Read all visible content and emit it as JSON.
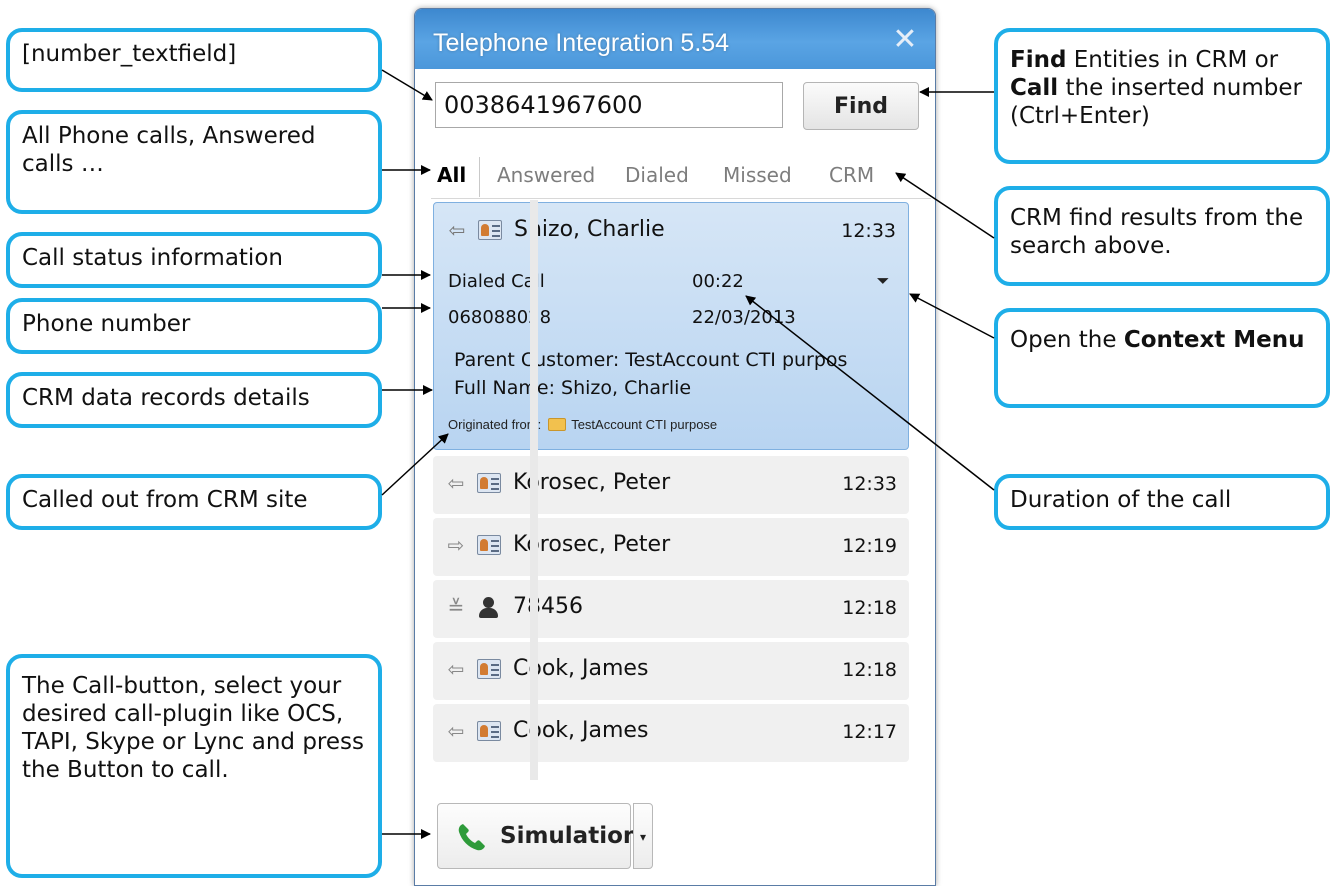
{
  "window": {
    "title": "Telephone Integration 5.54",
    "close_glyph": "✕"
  },
  "search": {
    "number_value": "0038641967600",
    "find_label": "Find"
  },
  "tabs": [
    "All",
    "Answered",
    "Dialed",
    "Missed",
    "CRM"
  ],
  "calls": {
    "expanded": {
      "name": "Shizo, Charlie",
      "time": "12:33",
      "status": "Dialed Call",
      "duration": "00:22",
      "number": "068088028",
      "date": "22/03/2013",
      "parent_customer": "Parent Customer: TestAccount CTI purpos",
      "full_name": "Full Name: Shizo, Charlie",
      "originated_label": "Originated from:",
      "originated_value": "TestAccount CTI purpose"
    },
    "rows": [
      {
        "name": "Korosec, Peter",
        "time": "12:33",
        "direction": "outgoing-icon",
        "glyph": "⇦"
      },
      {
        "name": "Korosec, Peter",
        "time": "12:19",
        "direction": "incoming-icon",
        "glyph": "⇨"
      },
      {
        "name": "78456",
        "time": "12:18",
        "direction": "missed-icon",
        "glyph": "≚"
      },
      {
        "name": "Cook, James",
        "time": "12:18",
        "direction": "outgoing-icon",
        "glyph": "⇦"
      },
      {
        "name": "Cook, James",
        "time": "12:17",
        "direction": "outgoing-icon",
        "glyph": "⇦"
      }
    ],
    "expanded_direction_glyph": "⇦"
  },
  "call_button": {
    "label": "Simulation",
    "dropdown_glyph": "▾"
  },
  "context_menu_glyph": "⏷",
  "callouts": {
    "number_textfield": "[number_textfield]",
    "all_calls": "All Phone calls, Answered calls …",
    "call_status": "Call status information",
    "phone_number": "Phone number",
    "crm_details": "CRM data records details",
    "called_out": "Called out from CRM site",
    "call_button": "The Call-button, select your desired call-plugin like OCS, TAPI, Skype or Lync and press the Button to call.",
    "find_bold1": "Find",
    "find_text1": " Entities in CRM or ",
    "find_bold2": "Call",
    "find_text2": " the inserted number (Ctrl+Enter)",
    "crm_find": "CRM find results from the search above.",
    "context_text": "Open the ",
    "context_bold": "Context Menu",
    "duration": "Duration of the call"
  },
  "colors": {
    "callout_border": "#1eaee8",
    "titlebar": "#4b97da",
    "selected_row": "#b8d4f1",
    "phone_green": "#2e9b3a"
  }
}
